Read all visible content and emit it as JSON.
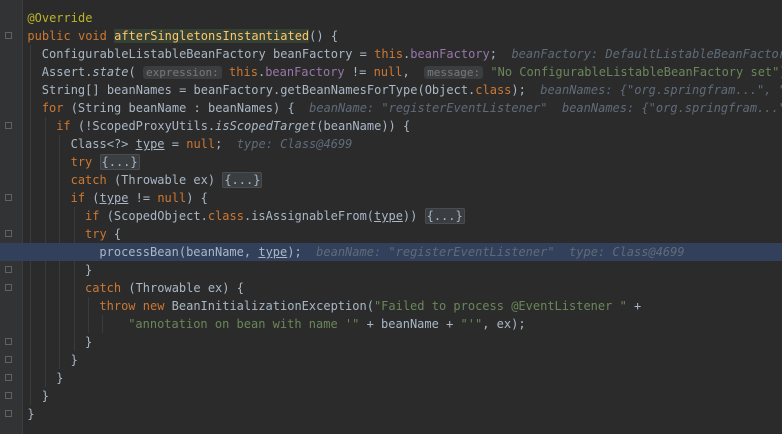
{
  "editor": {
    "lines": [
      {
        "indent": 2,
        "highlight": false,
        "tokens": [
          {
            "t": "@Override",
            "c": "ann"
          }
        ]
      },
      {
        "indent": 2,
        "highlight": false,
        "tokens": [
          {
            "t": "public void ",
            "c": "kw"
          },
          {
            "t": "afterSingletonsInstantiated",
            "c": "fn-decl"
          },
          {
            "t": "() {"
          }
        ]
      },
      {
        "indent": 4,
        "highlight": false,
        "tokens": [
          {
            "t": "ConfigurableListableBeanFactory beanFactory = "
          },
          {
            "t": "this",
            "c": "kw"
          },
          {
            "t": "."
          },
          {
            "t": "beanFactory",
            "c": "field"
          },
          {
            "t": ";"
          },
          {
            "t": "  beanFactory: DefaultListableBeanFactory@",
            "c": "inl"
          }
        ]
      },
      {
        "indent": 4,
        "highlight": false,
        "tokens": [
          {
            "t": "Assert."
          },
          {
            "t": "state",
            "c": "ital"
          },
          {
            "t": "( "
          },
          {
            "t": "expression:",
            "c": "hint"
          },
          {
            "t": " "
          },
          {
            "t": "this",
            "c": "kw"
          },
          {
            "t": "."
          },
          {
            "t": "beanFactory",
            "c": "field"
          },
          {
            "t": " != "
          },
          {
            "t": "null",
            "c": "kw"
          },
          {
            "t": ",  "
          },
          {
            "t": "message:",
            "c": "hint"
          },
          {
            "t": " "
          },
          {
            "t": "\"No ConfigurableListableBeanFactory set\"",
            "c": "str"
          },
          {
            "t": ");"
          }
        ]
      },
      {
        "indent": 4,
        "highlight": false,
        "tokens": [
          {
            "t": "String[] beanNames = beanFactory.getBeanNamesForType(Object."
          },
          {
            "t": "class",
            "c": "kw"
          },
          {
            "t": ");"
          },
          {
            "t": "  beanNames: {\"org.springfram...\", \"",
            "c": "inl"
          }
        ]
      },
      {
        "indent": 4,
        "highlight": false,
        "tokens": [
          {
            "t": "for ",
            "c": "kw"
          },
          {
            "t": "(String beanName : beanNames) {"
          },
          {
            "t": "  beanName: \"registerEventListener\"  beanNames: {\"org.springfram...\"",
            "c": "inl"
          }
        ]
      },
      {
        "indent": 6,
        "highlight": false,
        "tokens": [
          {
            "t": "if ",
            "c": "kw"
          },
          {
            "t": "(!ScopedProxyUtils."
          },
          {
            "t": "isScopedTarget",
            "c": "ital"
          },
          {
            "t": "(beanName)) {"
          }
        ]
      },
      {
        "indent": 8,
        "highlight": false,
        "tokens": [
          {
            "t": "Class<?> "
          },
          {
            "t": "type",
            "c": "und"
          },
          {
            "t": " = "
          },
          {
            "t": "null",
            "c": "kw"
          },
          {
            "t": ";"
          },
          {
            "t": "  type: Class@4699",
            "c": "inl"
          }
        ]
      },
      {
        "indent": 8,
        "highlight": false,
        "tokens": [
          {
            "t": "try ",
            "c": "kw"
          },
          {
            "t": "{...}",
            "c": "fold-chip"
          }
        ]
      },
      {
        "indent": 8,
        "highlight": false,
        "tokens": [
          {
            "t": "catch ",
            "c": "kw"
          },
          {
            "t": "(Throwable ex) "
          },
          {
            "t": "{...}",
            "c": "fold-chip"
          }
        ]
      },
      {
        "indent": 8,
        "highlight": false,
        "tokens": [
          {
            "t": "if ",
            "c": "kw"
          },
          {
            "t": "("
          },
          {
            "t": "type",
            "c": "und"
          },
          {
            "t": " != "
          },
          {
            "t": "null",
            "c": "kw"
          },
          {
            "t": ") {"
          }
        ]
      },
      {
        "indent": 10,
        "highlight": false,
        "tokens": [
          {
            "t": "if ",
            "c": "kw"
          },
          {
            "t": "(ScopedObject."
          },
          {
            "t": "class",
            "c": "kw"
          },
          {
            "t": ".isAssignableFrom("
          },
          {
            "t": "type",
            "c": "und"
          },
          {
            "t": ")) "
          },
          {
            "t": "{...}",
            "c": "fold-chip"
          }
        ]
      },
      {
        "indent": 10,
        "highlight": false,
        "tokens": [
          {
            "t": "try ",
            "c": "kw"
          },
          {
            "t": "{"
          }
        ]
      },
      {
        "indent": 12,
        "highlight": true,
        "tokens": [
          {
            "t": "processBean(beanName, "
          },
          {
            "t": "type",
            "c": "und"
          },
          {
            "t": ");"
          },
          {
            "t": "  beanName: \"registerEventListener\"  type: Class@4699",
            "c": "inl"
          }
        ]
      },
      {
        "indent": 10,
        "highlight": false,
        "tokens": [
          {
            "t": "}"
          }
        ]
      },
      {
        "indent": 10,
        "highlight": false,
        "tokens": [
          {
            "t": "catch ",
            "c": "kw"
          },
          {
            "t": "(Throwable ex) {"
          }
        ]
      },
      {
        "indent": 12,
        "highlight": false,
        "tokens": [
          {
            "t": "throw new ",
            "c": "kw"
          },
          {
            "t": "BeanInitializationException("
          },
          {
            "t": "\"Failed to process @EventListener \"",
            "c": "str"
          },
          {
            "t": " +"
          }
        ]
      },
      {
        "indent": 16,
        "highlight": false,
        "tokens": [
          {
            "t": "\"annotation on bean with name '\"",
            "c": "str"
          },
          {
            "t": " + beanName + "
          },
          {
            "t": "\"'\"",
            "c": "str"
          },
          {
            "t": ", ex);"
          }
        ]
      },
      {
        "indent": 10,
        "highlight": false,
        "tokens": [
          {
            "t": "}"
          }
        ]
      },
      {
        "indent": 8,
        "highlight": false,
        "tokens": [
          {
            "t": "}"
          }
        ]
      },
      {
        "indent": 6,
        "highlight": false,
        "tokens": [
          {
            "t": "}"
          }
        ]
      },
      {
        "indent": 4,
        "highlight": false,
        "tokens": [
          {
            "t": "}"
          }
        ]
      },
      {
        "indent": 2,
        "highlight": false,
        "tokens": [
          {
            "t": "}"
          }
        ]
      }
    ]
  },
  "colors": {
    "background": "#2b2b2b",
    "gutter": "#313335",
    "highlight_line": "#32405b",
    "keyword": "#cc7832",
    "annotation": "#bbb529",
    "method_decl": "#ffc66d",
    "field": "#9876aa",
    "string": "#6a8759",
    "inline_value": "#5f6b7a"
  }
}
